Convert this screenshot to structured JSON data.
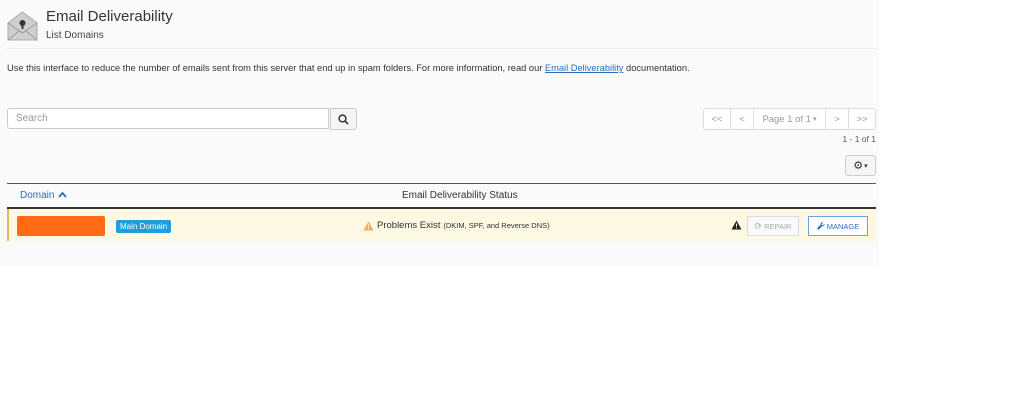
{
  "header": {
    "title": "Email Deliverability",
    "subtitle": "List Domains",
    "icon": "envelope-icon"
  },
  "description": {
    "before_link": "Use this interface to reduce the number of emails sent from this server that end up in spam folders. For more information, read our ",
    "link_text": "Email Deliverability",
    "after_link": " documentation."
  },
  "search": {
    "placeholder": "Search"
  },
  "pagination": {
    "first": "<<",
    "prev": "<",
    "page_label": "Page 1 of 1",
    "next": ">",
    "last": ">>",
    "count": "1 - 1 of 1"
  },
  "table": {
    "col_domain": "Domain",
    "col_status": "Email Deliverability Status",
    "rows": [
      {
        "badge": "Main Domain",
        "status": "Problems Exist",
        "status_detail": "(DKIM, SPF, and Reverse DNS)",
        "repair_label": "REPAIR",
        "manage_label": "MANAGE"
      }
    ]
  },
  "colors": {
    "link": "#2a6ebb",
    "badge": "#1f9fd9",
    "warning_row": "#fcf8e3",
    "warning_icon": "#f0ad4e",
    "redaction": "#ff6a14"
  }
}
